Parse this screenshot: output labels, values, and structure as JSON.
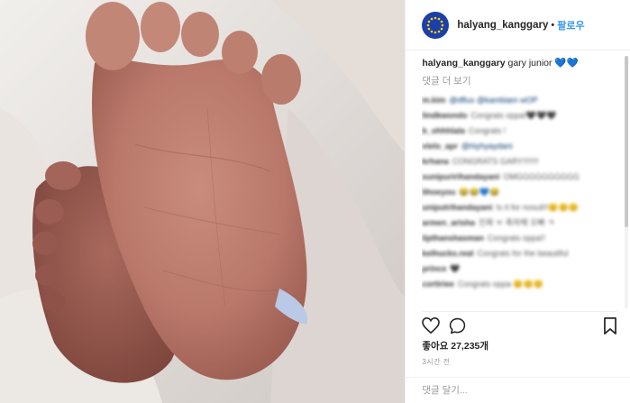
{
  "post": {
    "username": "halyang_kanggary",
    "follow_label": "팔로우",
    "separator": "•",
    "caption_text": "gary junior 💙💙",
    "view_more": "댓글 더 보기",
    "likes": "좋아요 27,235개",
    "time_ago": "3시간 전",
    "comment_placeholder": "댓글 달기..."
  },
  "comments": [
    {
      "user": "m.kim",
      "text": "@dflux @kambiam wOP",
      "link": true
    },
    {
      "user": "lindkwondo",
      "text": "Congrats oppa!🖤🖤🖤"
    },
    {
      "user": "b_ohhhlala",
      "text": "Congrats !"
    },
    {
      "user": "vielo_apr",
      "text": "@hiyhyaydani",
      "link": true
    },
    {
      "user": "krhana",
      "text": "CONGRATS GARY!!!!!!!"
    },
    {
      "user": "sunipuririhandayani",
      "text": "OMGGGGGGGGGG"
    },
    {
      "user": "lihoeyou",
      "text": "😂😂💙😂"
    },
    {
      "user": "uniputrihandayani",
      "text": "Is it for nosuli!!😊😊😊"
    },
    {
      "user": "armen_arisha",
      "text": "진짜 ㅠ 축하해 오빠 ㅋ"
    },
    {
      "user": "lipthanshasman",
      "text": "Congrats oppa!!"
    },
    {
      "user": "kelhucks.real",
      "text": "Congrats for the beautiful"
    },
    {
      "user": "prince",
      "text": "🖤"
    },
    {
      "user": "cortiriee",
      "text": "Congrats oppa 😊😊😊"
    }
  ],
  "icons": {
    "avatar": "eu-stars-avatar-icon",
    "like": "heart-icon",
    "comment": "speech-bubble-icon",
    "save": "bookmark-icon"
  },
  "colors": {
    "follow": "#3897f0",
    "avatar_bg": "#1c3fa8",
    "star": "#ffd400"
  }
}
